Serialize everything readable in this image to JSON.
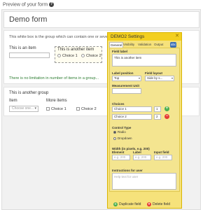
{
  "page": {
    "preview_title": "Preview of your form",
    "help_icon": "?"
  },
  "form": {
    "title": "Demo form",
    "group_description": "This white box is the group which can contain one or several items...",
    "item1_label": "This is an item",
    "item2_label": "This is another item",
    "choice_1": "Choice 1",
    "choice_2": "Choice 2",
    "no_limit_note": "There is no limitation in number of items in a group...",
    "group2_title": "This is another group",
    "item_label": "Item",
    "more_items_label": "More items",
    "dropdown_placeholder": "Choose one...",
    "check_choice_1": "Choice 1",
    "check_choice_2": "Choice 2"
  },
  "panel": {
    "title": "DEMO2 Settings",
    "tabs": [
      "General",
      "Visibility",
      "Validation",
      "Output"
    ],
    "more_tab": "abc",
    "field_label_title": "Field label",
    "field_label_value": "This is another item",
    "label_position_title": "Label position",
    "label_position_value": "Top",
    "field_layout_title": "Field layout",
    "field_layout_value": "Side by s...",
    "measurement_unit_title": "Measurement Unit",
    "choices_title": "Choices",
    "choices": [
      {
        "label": "Choice 1",
        "value": "1"
      },
      {
        "label": "Choice 2",
        "value": "2"
      }
    ],
    "control_type_title": "Control Type",
    "control_radio": "Radio",
    "control_dropdown": "Dropdown",
    "width_title": "Width (in pixels, e.g. 200)",
    "element_title": "Element",
    "label_title": "Label",
    "input_field_title": "Input field",
    "width_placeholder": "e.g. 200",
    "instructions_title": "Instructions for user",
    "instructions_placeholder": "Help text for user",
    "duplicate_label": "Duplicate field",
    "delete_label": "Delete field"
  },
  "colors": {
    "panel_bg": "#f6e27b",
    "panel_header": "#f3cf1f",
    "note_green": "#2e7d32",
    "add_green": "#4caf50",
    "delete_red": "#e53935"
  }
}
